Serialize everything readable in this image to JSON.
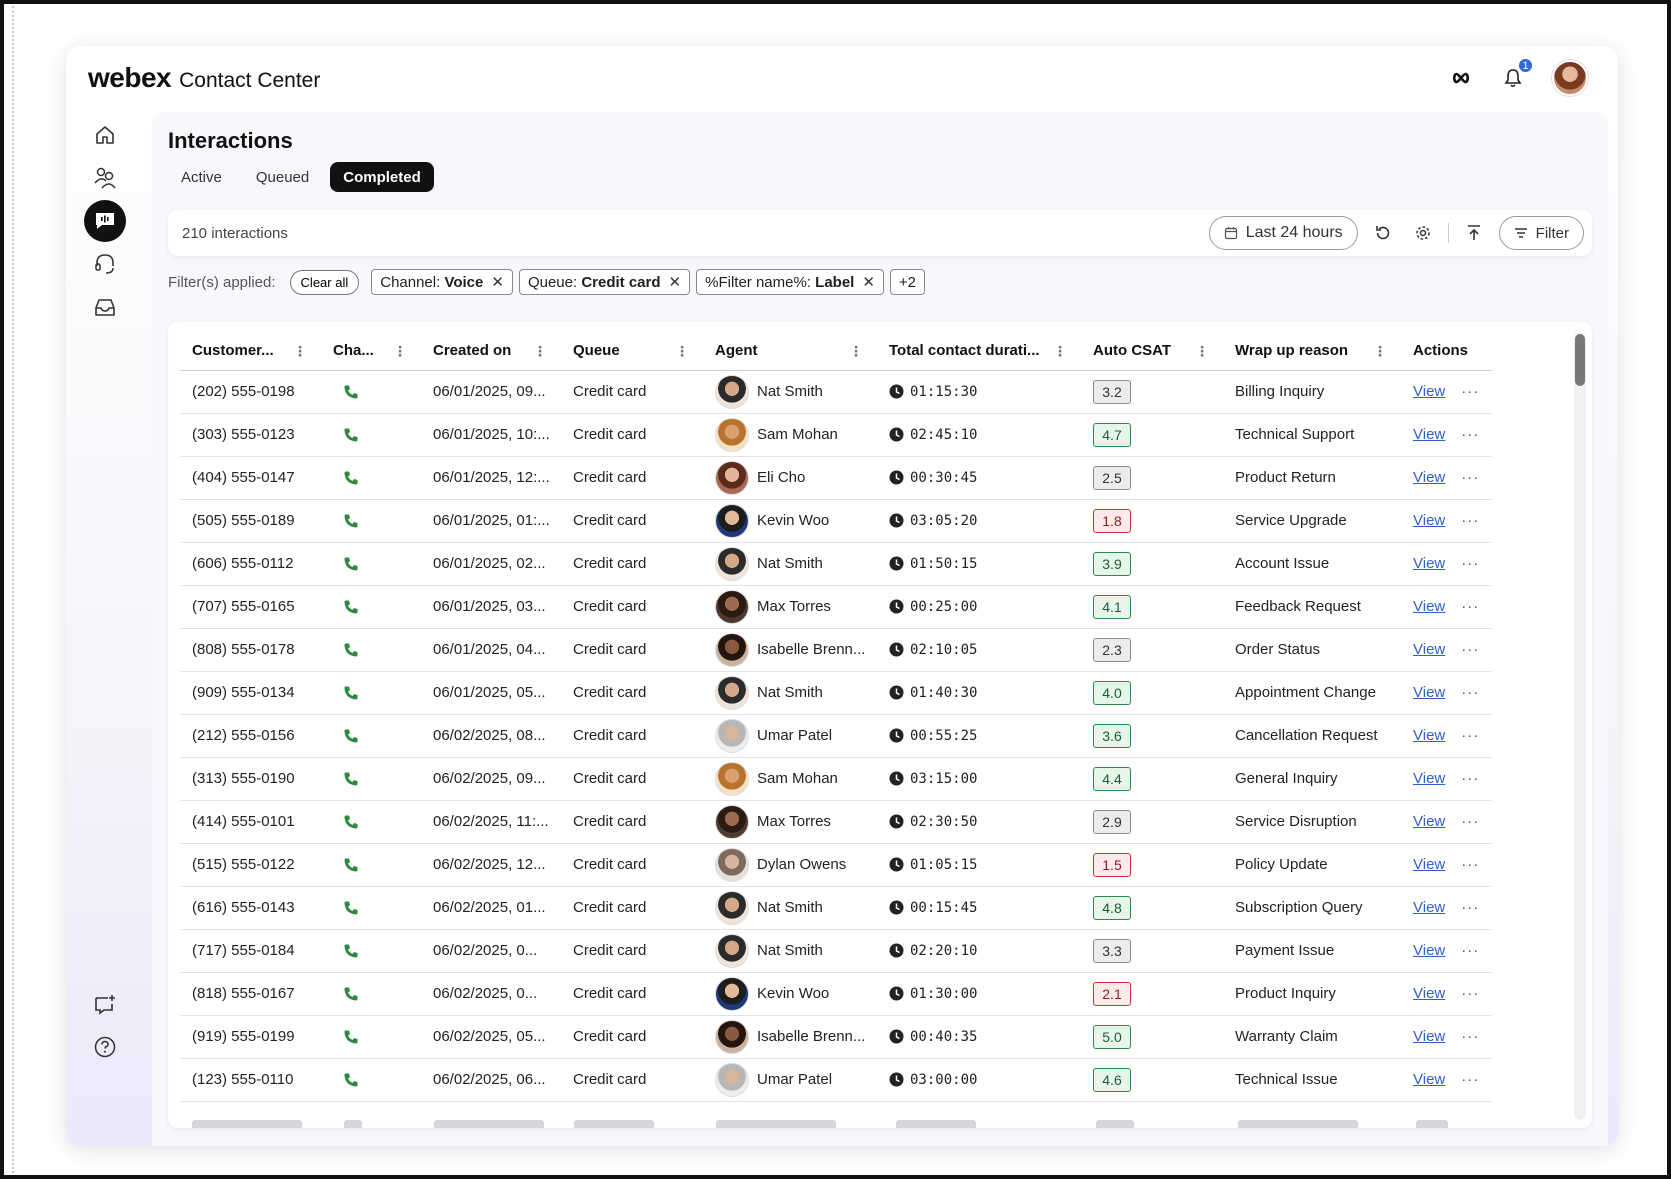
{
  "brand": {
    "logo": "webex",
    "product": "Contact Center"
  },
  "topbar": {
    "notification_count": "1"
  },
  "page": {
    "title": "Interactions",
    "tabs": [
      {
        "label": "Active",
        "active": false
      },
      {
        "label": "Queued",
        "active": false
      },
      {
        "label": "Completed",
        "active": true
      }
    ]
  },
  "toolbar": {
    "count": "210 interactions",
    "range_label": "Last 24 hours",
    "filter_label": "Filter"
  },
  "filters": {
    "label": "Filter(s) applied:",
    "clear_label": "Clear all",
    "chips": [
      {
        "key": "Channel:",
        "value": "Voice"
      },
      {
        "key": "Queue:",
        "value": "Credit card"
      },
      {
        "key": "%Filter name%:",
        "value": "Label"
      }
    ],
    "more": "+2"
  },
  "table": {
    "columns": [
      "Customer...",
      "Cha...",
      "Created on",
      "Queue",
      "Agent",
      "Total contact durati...",
      "Auto CSAT",
      "Wrap up reason",
      "Actions"
    ],
    "view_label": "View",
    "rows": [
      {
        "customer": "(202) 555-0198",
        "created": "06/01/2025, 09...",
        "queue": "Credit card",
        "agent": "Nat Smith",
        "duration": "01:15:30",
        "csat": "3.2",
        "csat_level": "mid",
        "reason": "Billing Inquiry"
      },
      {
        "customer": "(303) 555-0123",
        "created": "06/01/2025, 10:...",
        "queue": "Credit card",
        "agent": "Sam Mohan",
        "duration": "02:45:10",
        "csat": "4.7",
        "csat_level": "high",
        "reason": "Technical Support"
      },
      {
        "customer": "(404) 555-0147",
        "created": "06/01/2025, 12:...",
        "queue": "Credit card",
        "agent": "Eli Cho",
        "duration": "00:30:45",
        "csat": "2.5",
        "csat_level": "mid",
        "reason": "Product Return"
      },
      {
        "customer": "(505) 555-0189",
        "created": "06/01/2025, 01:...",
        "queue": "Credit card",
        "agent": "Kevin Woo",
        "duration": "03:05:20",
        "csat": "1.8",
        "csat_level": "low",
        "reason": "Service Upgrade"
      },
      {
        "customer": "(606) 555-0112",
        "created": "06/01/2025, 02...",
        "queue": "Credit card",
        "agent": "Nat Smith",
        "duration": "01:50:15",
        "csat": "3.9",
        "csat_level": "high",
        "reason": "Account Issue"
      },
      {
        "customer": "(707) 555-0165",
        "created": "06/01/2025, 03...",
        "queue": "Credit card",
        "agent": "Max Torres",
        "duration": "00:25:00",
        "csat": "4.1",
        "csat_level": "high",
        "reason": "Feedback Request"
      },
      {
        "customer": "(808) 555-0178",
        "created": "06/01/2025, 04...",
        "queue": "Credit card",
        "agent": "Isabelle Brenn...",
        "duration": "02:10:05",
        "csat": "2.3",
        "csat_level": "mid",
        "reason": "Order Status"
      },
      {
        "customer": "(909) 555-0134",
        "created": "06/01/2025, 05...",
        "queue": "Credit card",
        "agent": "Nat Smith",
        "duration": "01:40:30",
        "csat": "4.0",
        "csat_level": "high",
        "reason": "Appointment Change"
      },
      {
        "customer": "(212) 555-0156",
        "created": "06/02/2025, 08...",
        "queue": "Credit card",
        "agent": "Umar Patel",
        "duration": "00:55:25",
        "csat": "3.6",
        "csat_level": "high",
        "reason": "Cancellation Request"
      },
      {
        "customer": "(313) 555-0190",
        "created": "06/02/2025, 09...",
        "queue": "Credit card",
        "agent": "Sam Mohan",
        "duration": "03:15:00",
        "csat": "4.4",
        "csat_level": "high",
        "reason": "General Inquiry"
      },
      {
        "customer": "(414) 555-0101",
        "created": "06/02/2025, 11:...",
        "queue": "Credit card",
        "agent": "Max Torres",
        "duration": "02:30:50",
        "csat": "2.9",
        "csat_level": "mid",
        "reason": "Service Disruption"
      },
      {
        "customer": "(515) 555-0122",
        "created": "06/02/2025, 12...",
        "queue": "Credit card",
        "agent": "Dylan Owens",
        "duration": "01:05:15",
        "csat": "1.5",
        "csat_level": "low",
        "reason": "Policy Update"
      },
      {
        "customer": "(616) 555-0143",
        "created": "06/02/2025, 01...",
        "queue": "Credit card",
        "agent": "Nat Smith",
        "duration": "00:15:45",
        "csat": "4.8",
        "csat_level": "high",
        "reason": "Subscription Query"
      },
      {
        "customer": "(717) 555-0184",
        "created": "06/02/2025, 0...",
        "queue": "Credit card",
        "agent": "Nat Smith",
        "duration": "02:20:10",
        "csat": "3.3",
        "csat_level": "mid",
        "reason": "Payment Issue"
      },
      {
        "customer": "(818) 555-0167",
        "created": "06/02/2025, 0...",
        "queue": "Credit card",
        "agent": "Kevin Woo",
        "duration": "01:30:00",
        "csat": "2.1",
        "csat_level": "low",
        "reason": "Product Inquiry"
      },
      {
        "customer": "(919) 555-0199",
        "created": "06/02/2025, 05...",
        "queue": "Credit card",
        "agent": "Isabelle Brenn...",
        "duration": "00:40:35",
        "csat": "5.0",
        "csat_level": "high",
        "reason": "Warranty Claim"
      },
      {
        "customer": "(123) 555-0110",
        "created": "06/02/2025, 06...",
        "queue": "Credit card",
        "agent": "Umar Patel",
        "duration": "03:00:00",
        "csat": "4.6",
        "csat_level": "high",
        "reason": "Technical Issue"
      }
    ]
  },
  "colors": {
    "accent_dark": "#111111",
    "link": "#2f5fc7",
    "phone_icon": "#2f8a3e",
    "csat_high": "#2c8a4a",
    "csat_low": "#c23b3b",
    "badge": "#2f6ad9"
  },
  "icons": {
    "nav": [
      "home-icon",
      "team-icon",
      "interactions-icon",
      "headset-icon",
      "inbox-icon",
      "feedback-icon",
      "help-icon"
    ],
    "top": [
      "infinity-icon",
      "bell-icon"
    ]
  }
}
